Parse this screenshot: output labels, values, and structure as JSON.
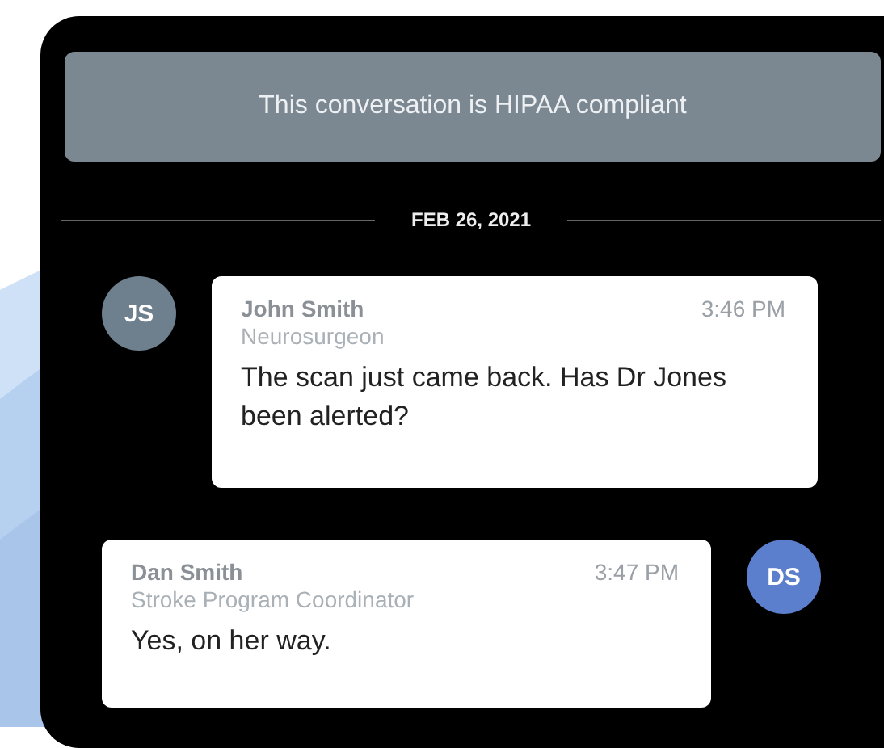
{
  "notice": "This conversation is HIPAA compliant",
  "date": "FEB 26, 2021",
  "messages": [
    {
      "kind": "incoming",
      "initials": "JS",
      "color": "#6e7f8d",
      "name": "John Smith",
      "role": "Neurosurgeon",
      "time": "3:46 PM",
      "text": "The scan just came back. Has Dr Jones been alerted?"
    },
    {
      "kind": "outgoing",
      "initials": "DS",
      "color": "#5b7fcc",
      "name": "Dan Smith",
      "role": "Stroke Program Coordinator",
      "time": "3:47 PM",
      "text": "Yes, on her way."
    }
  ]
}
